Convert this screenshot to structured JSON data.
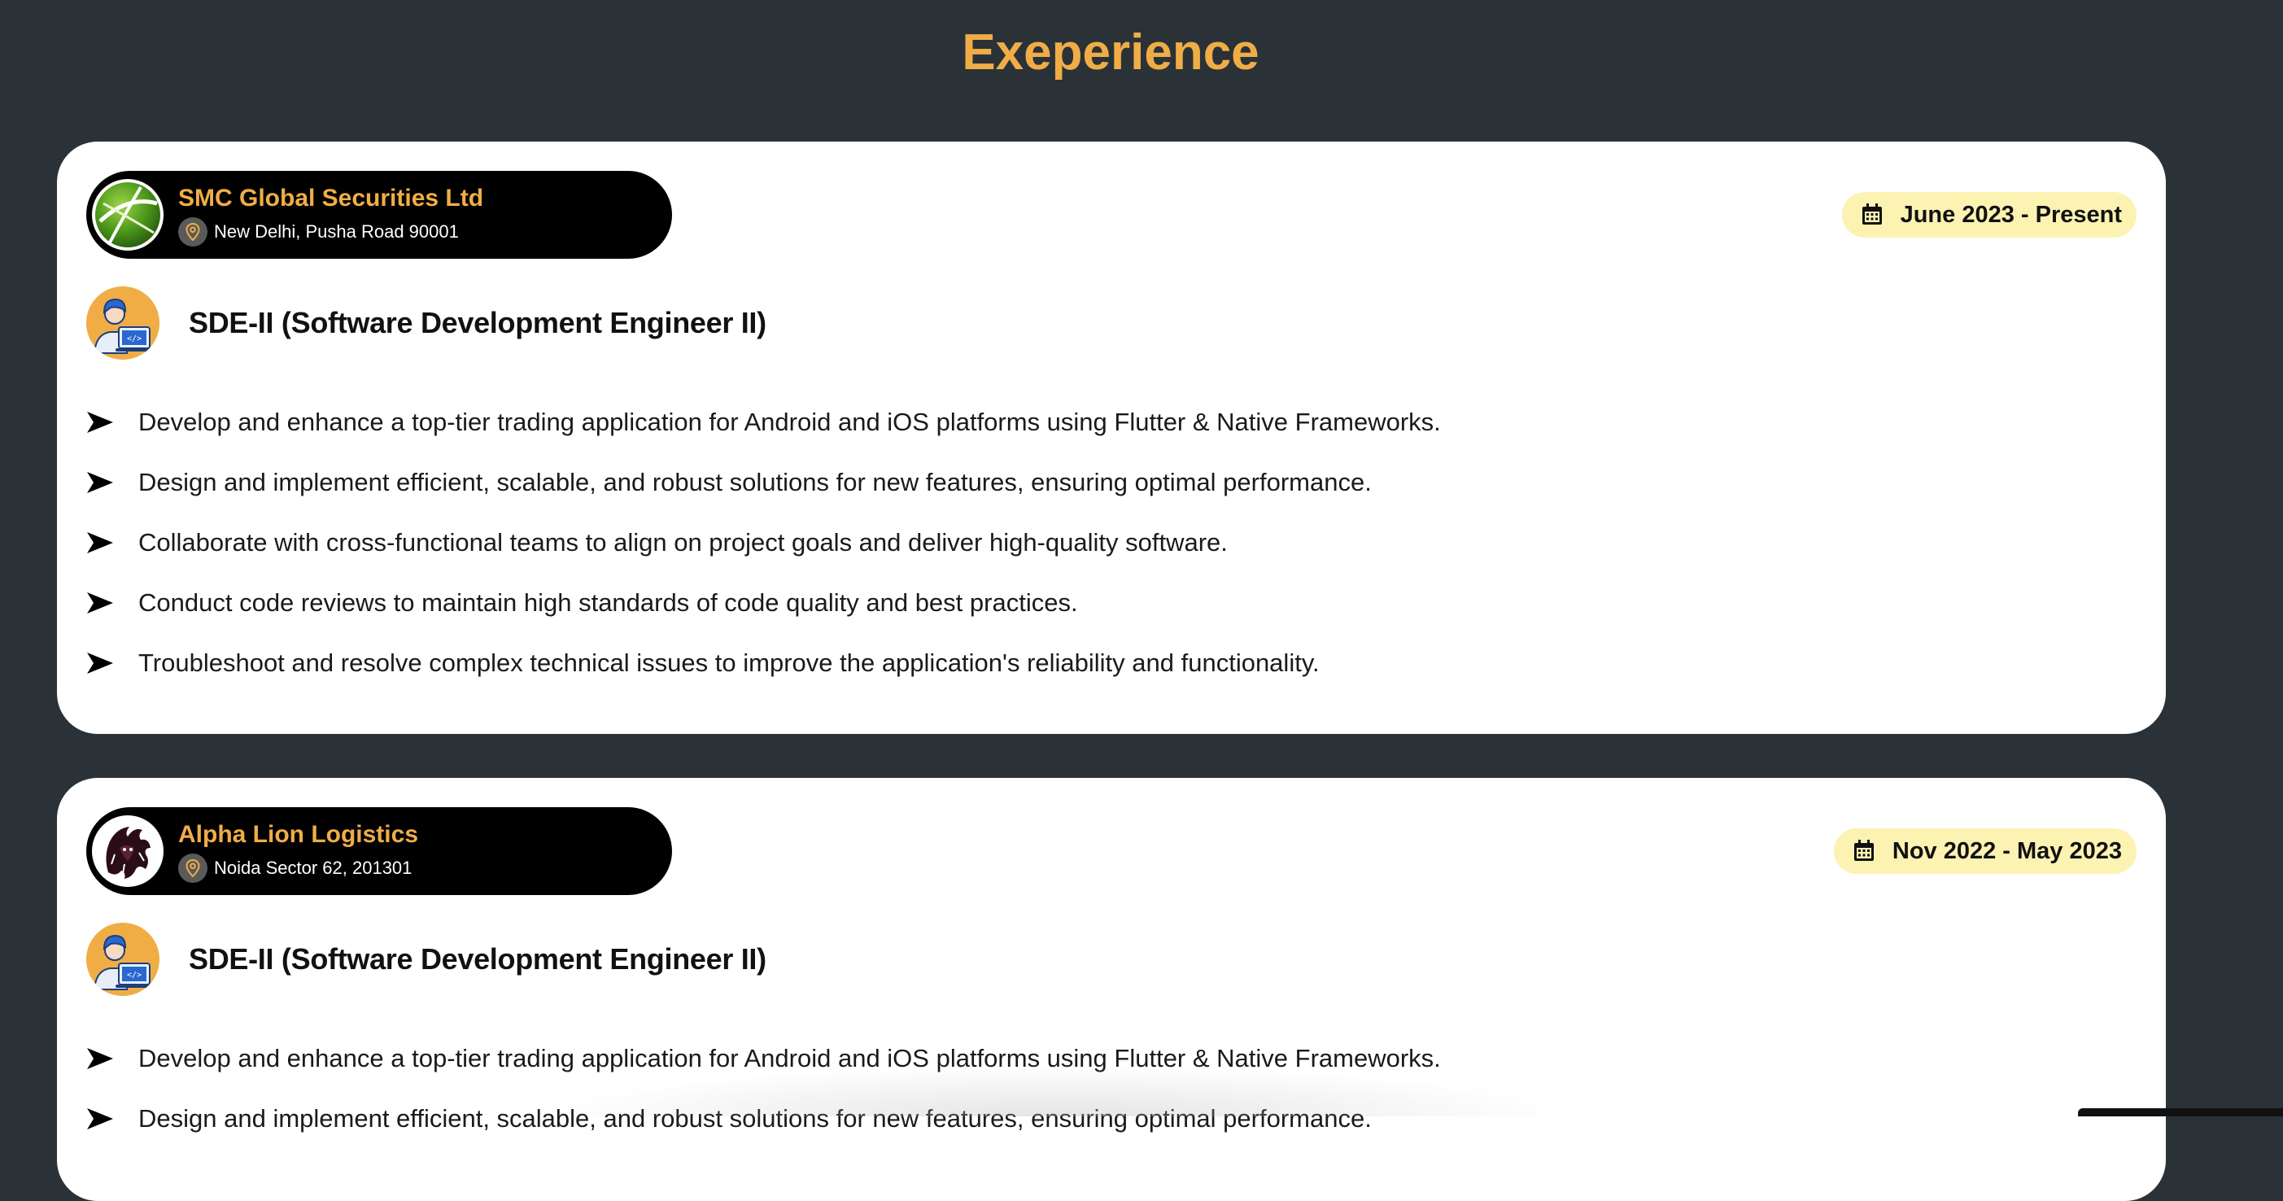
{
  "page": {
    "title": "Exeperience"
  },
  "colors": {
    "background": "#2a3238",
    "accent": "#f0ad46",
    "card": "#ffffff",
    "pill": "#000000",
    "date_badge": "#fcf2b2"
  },
  "experiences": [
    {
      "company": "SMC Global Securities Ltd",
      "location": "New Delhi, Pusha Road 90001",
      "logo_icon": "globe-logo-icon",
      "date_start": "June 2023",
      "date_end": "Present",
      "date_label": "June 2023 -  Present",
      "role": "SDE-II (Software Development Engineer II)",
      "duties": [
        "Develop and enhance a top-tier trading application for Android and iOS platforms using Flutter & Native Frameworks.",
        "Design and implement efficient, scalable, and robust solutions for new features, ensuring optimal performance.",
        "Collaborate with cross-functional teams to align on project goals and deliver high-quality software.",
        "Conduct code reviews to maintain high standards of code quality and best practices.",
        "Troubleshoot and resolve complex technical issues to improve the application's reliability and functionality."
      ]
    },
    {
      "company": "Alpha Lion Logistics",
      "location": "Noida Sector 62, 201301",
      "logo_icon": "lion-logo-icon",
      "date_start": "Nov 2022",
      "date_end": "May 2023",
      "date_label": "Nov 2022 -  May 2023",
      "role": "SDE-II (Software Development Engineer II)",
      "duties": [
        "Develop and enhance a top-tier trading application for Android and iOS platforms using Flutter & Native Frameworks.",
        "Design and implement efficient, scalable, and robust solutions for new features, ensuring optimal performance."
      ]
    }
  ]
}
